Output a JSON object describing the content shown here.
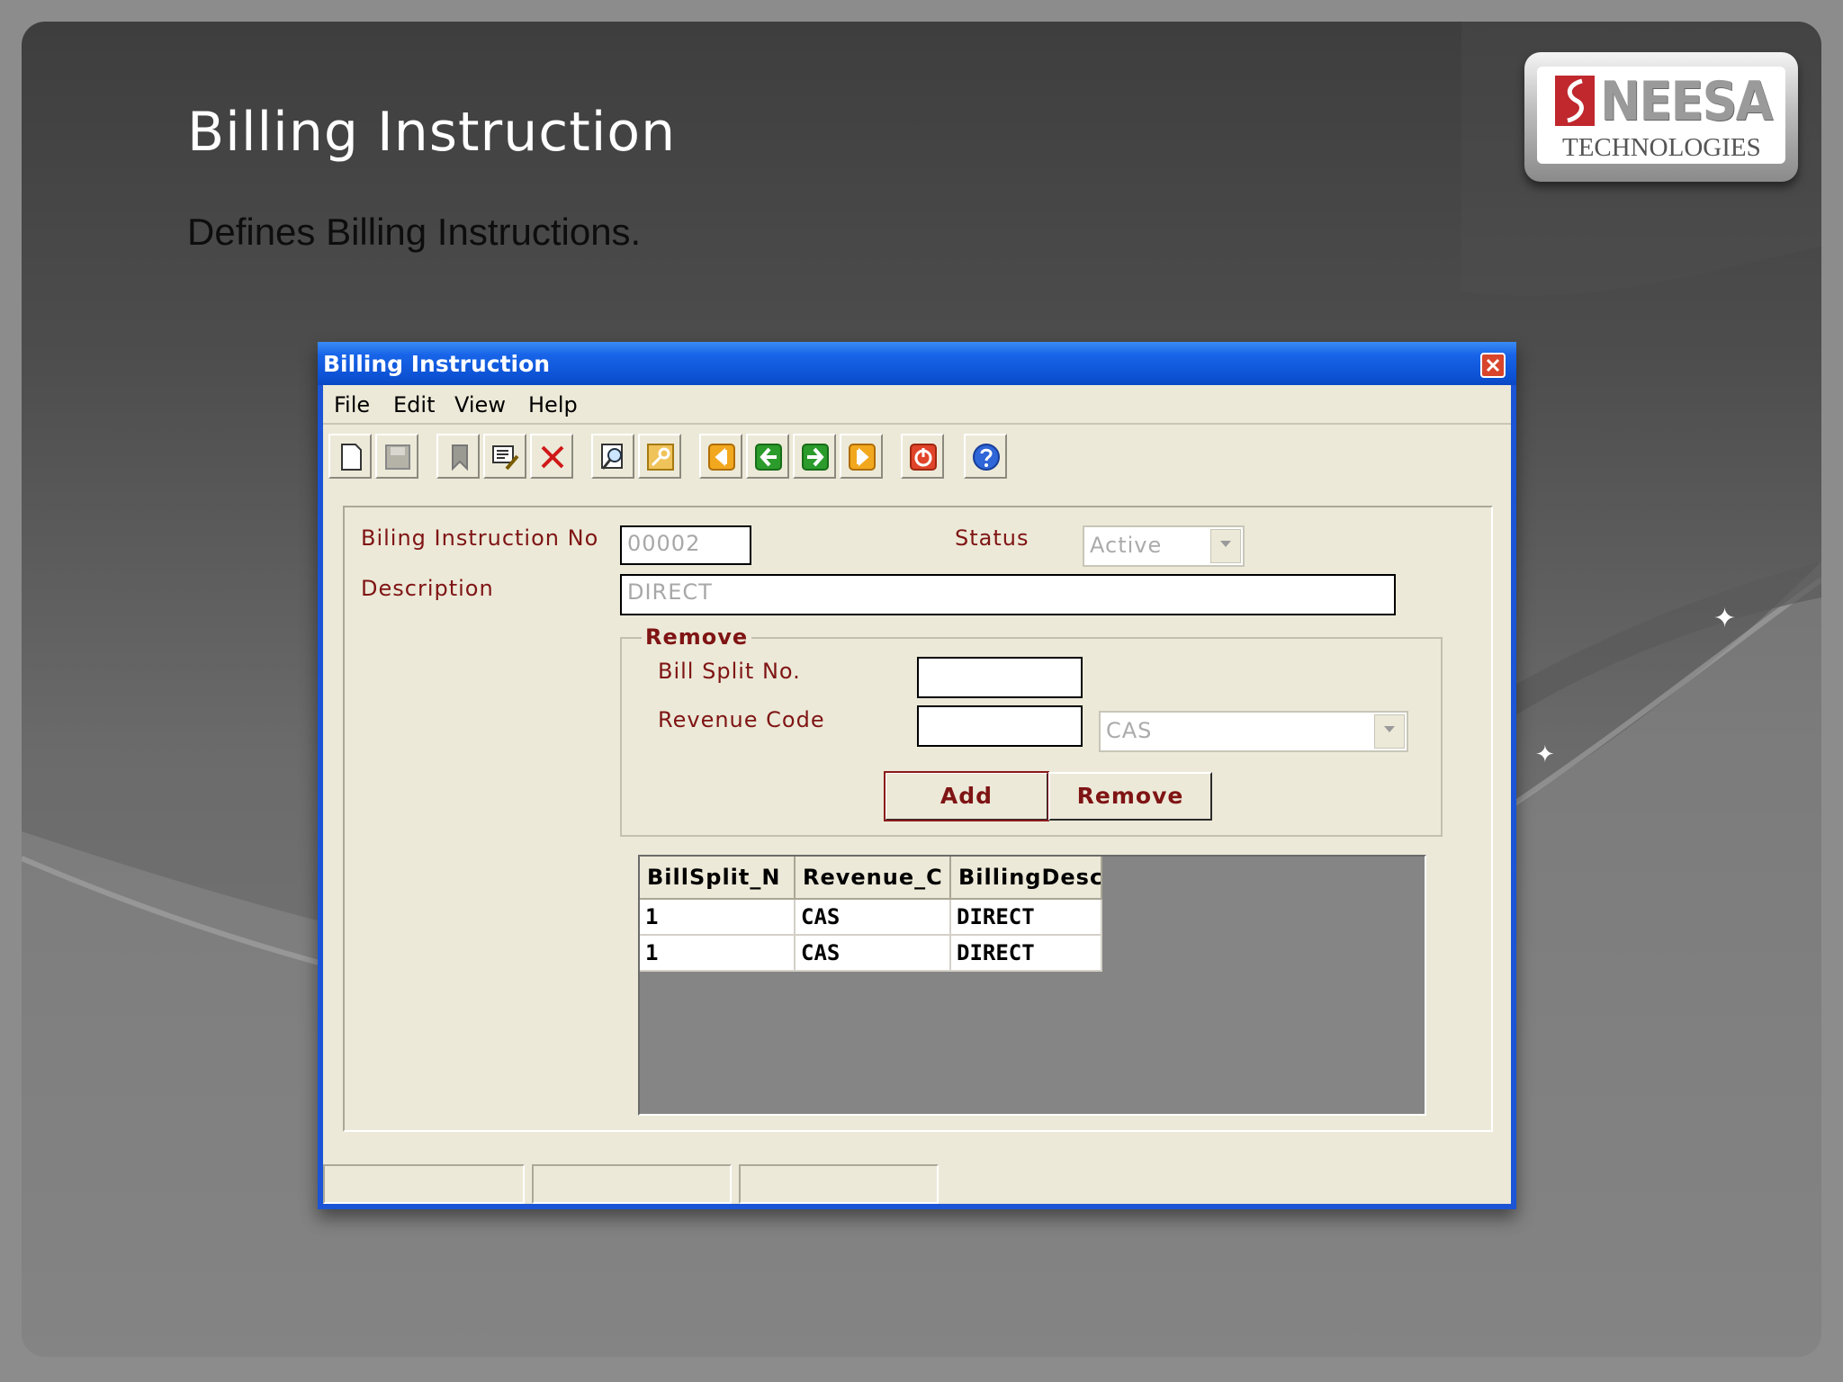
{
  "slide": {
    "title": "Billing Instruction",
    "subtitle": "Defines Billing Instructions."
  },
  "logo": {
    "name": "NEESA",
    "tagline": "TECHNOLOGIES"
  },
  "window": {
    "title": "Billing Instruction",
    "menu": [
      "File",
      "Edit",
      "View",
      "Help"
    ],
    "toolbar": [
      "new-icon",
      "save-icon",
      "bookmark-icon",
      "edit-icon",
      "delete-icon",
      "find-icon",
      "key-icon",
      "first-record-icon",
      "previous-record-icon",
      "next-record-icon",
      "last-record-icon",
      "exit-icon",
      "help-icon"
    ]
  },
  "form": {
    "billing_no_label": "Biling Instruction No",
    "billing_no_value": "00002",
    "status_label": "Status",
    "status_value": "Active",
    "description_label": "Description",
    "description_value": "DIRECT",
    "group_title": "Remove",
    "bill_split_label": "Bill Split No.",
    "bill_split_value": "",
    "revenue_code_label": "Revenue Code",
    "revenue_code_value": "",
    "revenue_code_combo": "CAS",
    "add_label": "Add",
    "remove_label": "Remove"
  },
  "grid": {
    "columns": [
      "BillSplit_N",
      "Revenue_C",
      "BillingDesc"
    ],
    "rows": [
      [
        "1",
        "CAS",
        "DIRECT"
      ],
      [
        "1",
        "CAS",
        "DIRECT"
      ]
    ]
  },
  "colors": {
    "title_bar": "#0d52d4",
    "label_text": "#7f1414",
    "client_bg": "#ece9d8",
    "grid_empty": "#858585"
  }
}
